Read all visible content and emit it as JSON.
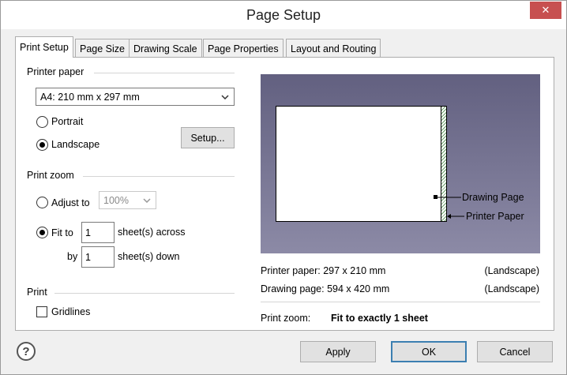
{
  "window": {
    "title": "Page Setup",
    "close_glyph": "✕"
  },
  "tabs": [
    {
      "label": "Print Setup",
      "active": true
    },
    {
      "label": "Page Size"
    },
    {
      "label": "Drawing Scale"
    },
    {
      "label": "Page Properties"
    },
    {
      "label": "Layout and Routing"
    }
  ],
  "printer_paper": {
    "group_label": "Printer paper",
    "paper_size": "A4:  210 mm x 297 mm",
    "portrait_label": "Portrait",
    "landscape_label": "Landscape",
    "orientation": "Landscape",
    "setup_button": "Setup..."
  },
  "print_zoom": {
    "group_label": "Print zoom",
    "adjust_to_label": "Adjust to",
    "adjust_value": "100%",
    "fit_to_label": "Fit to",
    "selected": "Fit to",
    "across_value": "1",
    "across_label": "sheet(s) across",
    "by_label": "by",
    "down_value": "1",
    "down_label": "sheet(s) down"
  },
  "print": {
    "group_label": "Print",
    "gridlines_label": "Gridlines",
    "gridlines_checked": false
  },
  "preview": {
    "drawing_page_label": "Drawing Page",
    "printer_paper_label": "Printer Paper"
  },
  "info": {
    "printer_paper_text": "Printer paper:  297 x 210 mm",
    "printer_paper_orientation": "(Landscape)",
    "drawing_page_text": "Drawing page: 594 x 420 mm",
    "drawing_page_orientation": "(Landscape)",
    "print_zoom_label": "Print zoom:",
    "print_zoom_value": "Fit to exactly 1 sheet"
  },
  "footer": {
    "help_glyph": "?",
    "apply": "Apply",
    "ok": "OK",
    "cancel": "Cancel"
  },
  "colors": {
    "preview_top": "#626080",
    "preview_bottom": "#8c8aa6",
    "close_button": "#c75050",
    "default_button_border": "#3c7fb1"
  }
}
